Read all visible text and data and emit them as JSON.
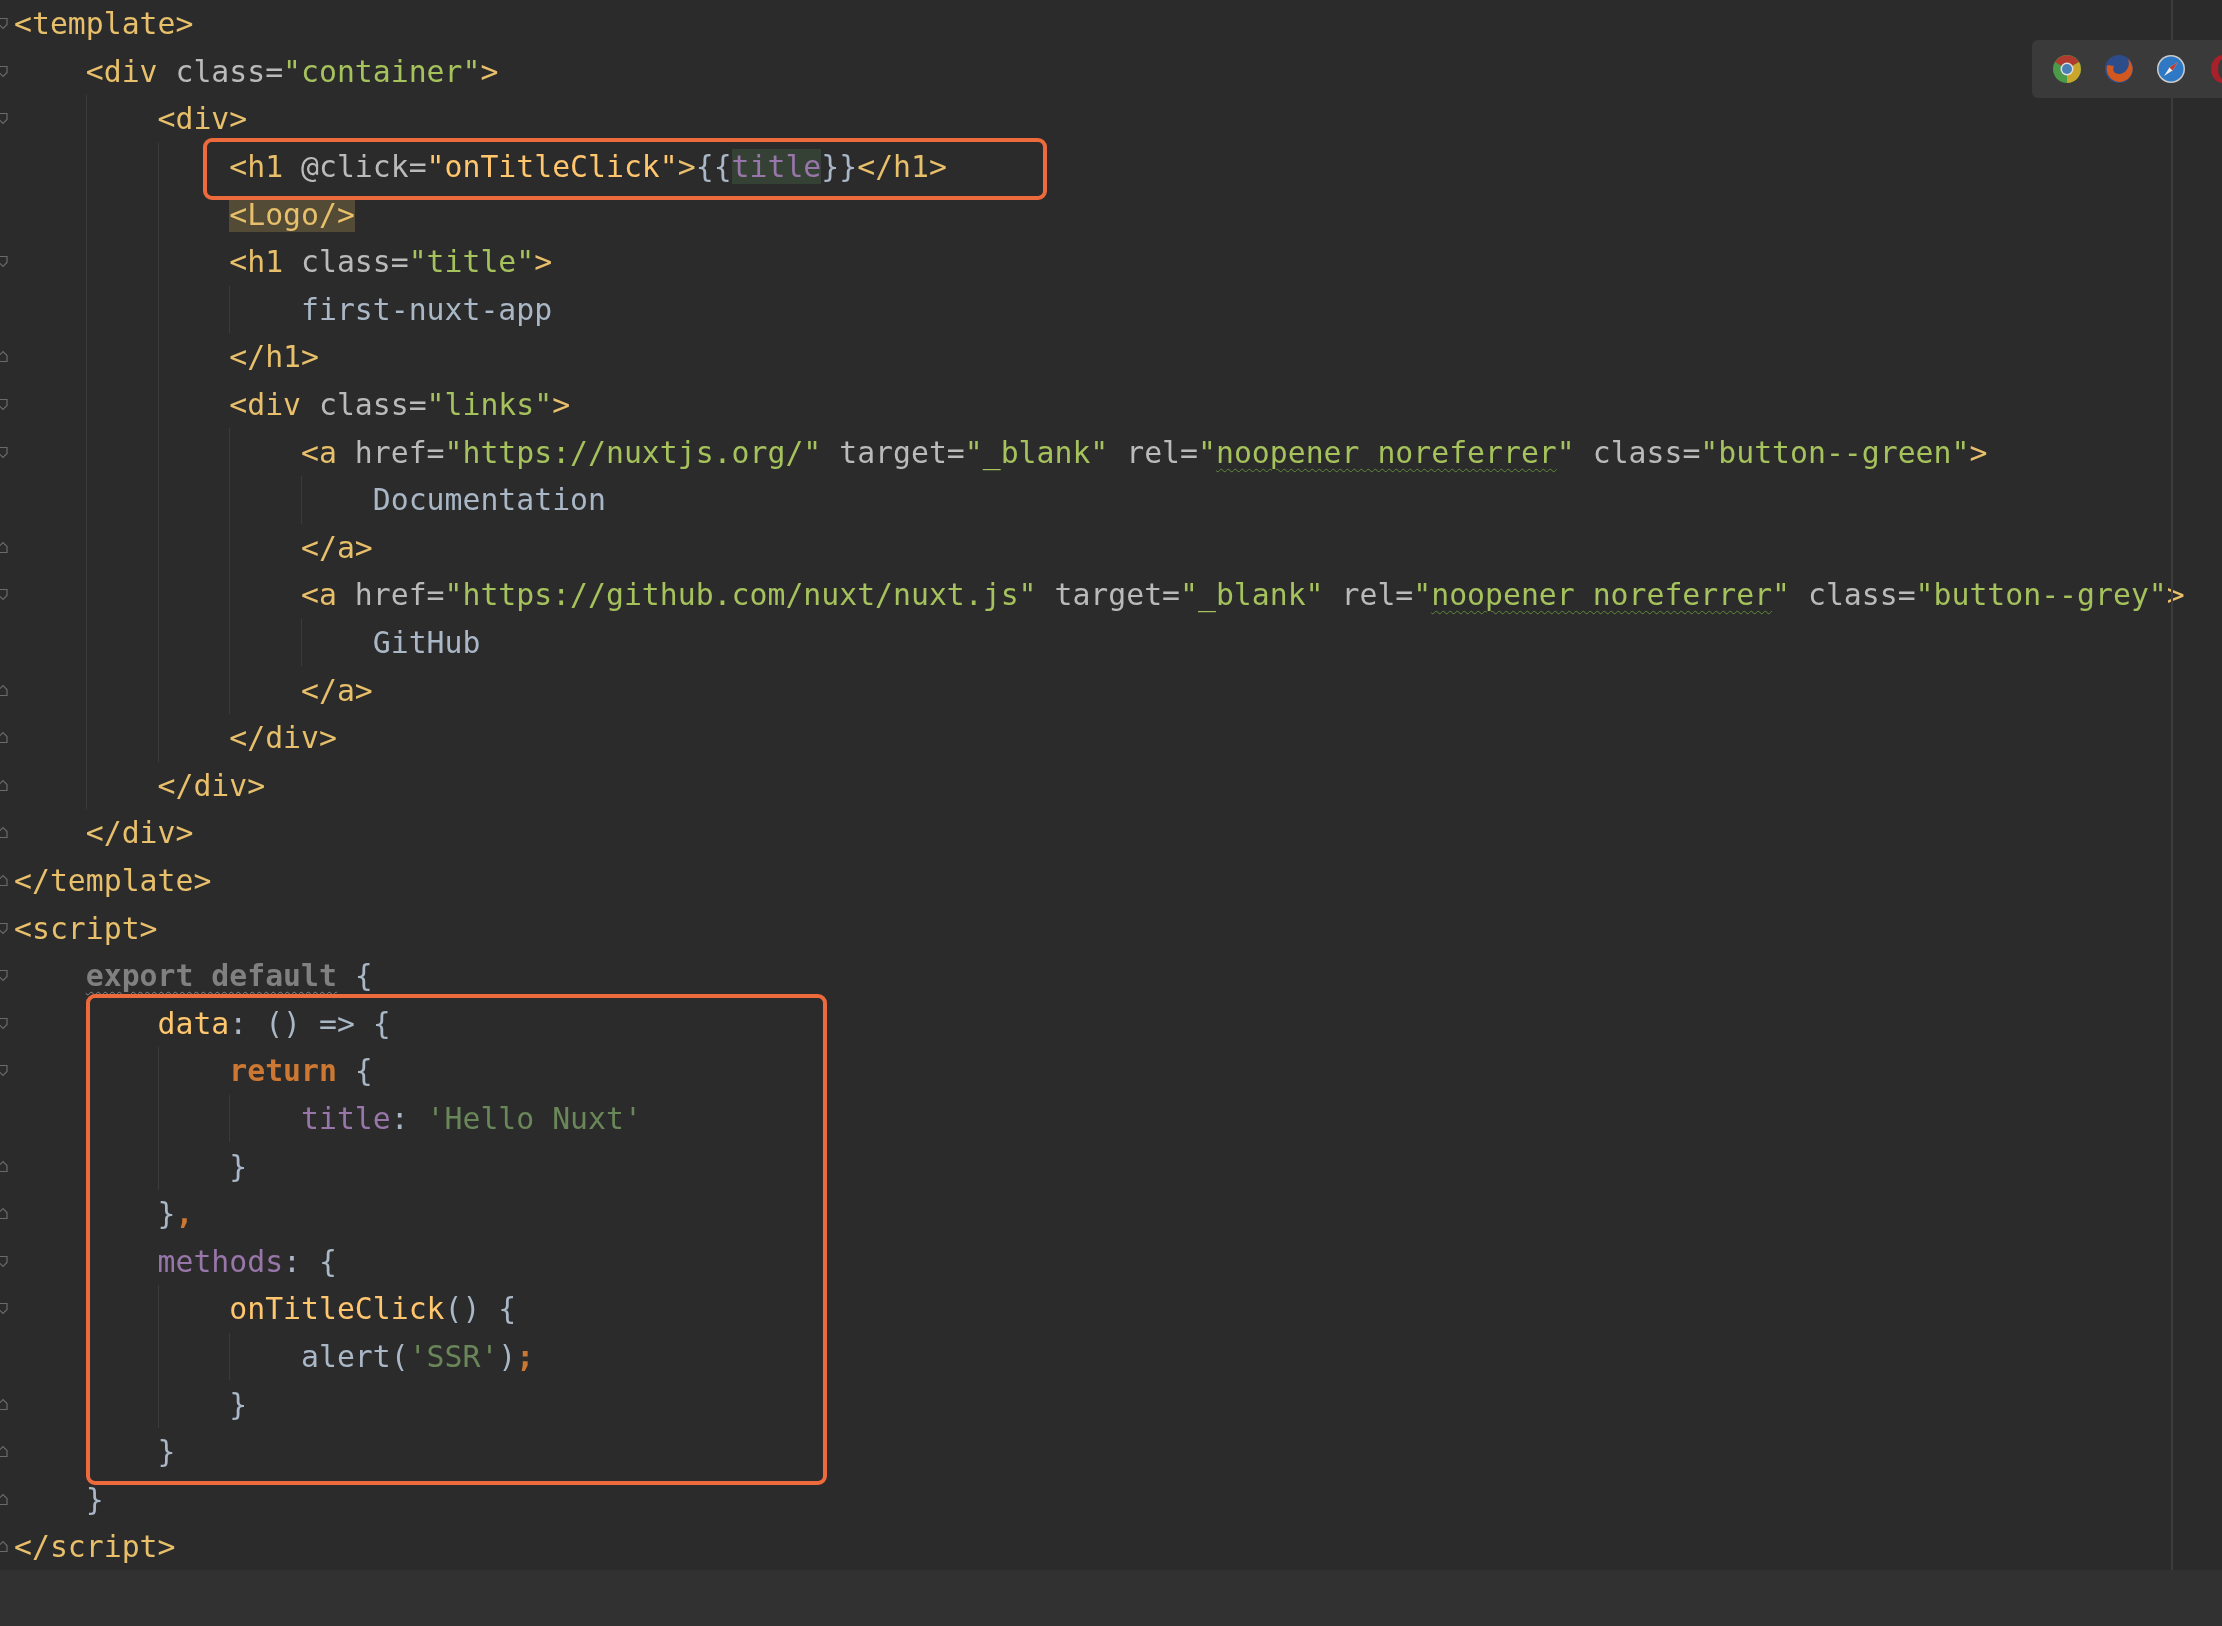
{
  "editor": {
    "lines": [
      {
        "kind": "fold-start",
        "tokens": [
          {
            "text": "<template>",
            "kind": "tag"
          }
        ],
        "children": [
          {
            "kind": "fold-start",
            "tokens": [
              {
                "text": "<div ",
                "kind": "tag"
              },
              {
                "text": "class=",
                "kind": "attr"
              },
              {
                "text": "\"container\"",
                "kind": "str"
              },
              {
                "text": ">",
                "kind": "tag"
              }
            ],
            "children": [
              {
                "kind": "fold-start",
                "tokens": [
                  {
                    "text": "<div>",
                    "kind": "tag"
                  }
                ],
                "children": [
                  {
                    "boxed": true,
                    "tokens": [
                      {
                        "text": "<h1 ",
                        "kind": "tag"
                      },
                      {
                        "text": "@click=",
                        "kind": "attr"
                      },
                      {
                        "text": "\"onTitleClick\"",
                        "kind": "fn"
                      },
                      {
                        "text": ">",
                        "kind": "tag"
                      },
                      {
                        "text": "{{",
                        "kind": "text"
                      },
                      {
                        "text": "title",
                        "kind": "prop",
                        "usage_highlight": true
                      },
                      {
                        "text": "}}",
                        "kind": "text"
                      },
                      {
                        "text": "</h1>",
                        "kind": "tag"
                      }
                    ]
                  },
                  {
                    "tokens": [
                      {
                        "text": "<Logo/>",
                        "kind": "tag",
                        "match_highlight": true
                      }
                    ]
                  },
                  {
                    "kind": "fold-start",
                    "tokens": [
                      {
                        "text": "<h1 ",
                        "kind": "tag"
                      },
                      {
                        "text": "class=",
                        "kind": "attr"
                      },
                      {
                        "text": "\"title\"",
                        "kind": "str"
                      },
                      {
                        "text": ">",
                        "kind": "tag"
                      }
                    ],
                    "children": [
                      {
                        "tokens": [
                          {
                            "text": "first-nuxt-app",
                            "kind": "text"
                          }
                        ]
                      }
                    ]
                  },
                  {
                    "kind": "fold-end",
                    "tokens": [
                      {
                        "text": "</h1>",
                        "kind": "tag"
                      }
                    ]
                  },
                  {
                    "kind": "fold-start",
                    "tokens": [
                      {
                        "text": "<div ",
                        "kind": "tag"
                      },
                      {
                        "text": "class=",
                        "kind": "attr"
                      },
                      {
                        "text": "\"links\"",
                        "kind": "str"
                      },
                      {
                        "text": ">",
                        "kind": "tag"
                      }
                    ],
                    "children": [
                      {
                        "kind": "fold-start",
                        "tokens": [
                          {
                            "text": "<a ",
                            "kind": "tag"
                          },
                          {
                            "text": "href=",
                            "kind": "attr"
                          },
                          {
                            "text": "\"https://nuxtjs.org/\"",
                            "kind": "str"
                          },
                          {
                            "text": " target=",
                            "kind": "attr"
                          },
                          {
                            "text": "\"_blank\"",
                            "kind": "str"
                          },
                          {
                            "text": " rel=",
                            "kind": "attr"
                          },
                          {
                            "text": "\"",
                            "kind": "str"
                          },
                          {
                            "text": "noopener noreferrer",
                            "kind": "str",
                            "squiggle": true
                          },
                          {
                            "text": "\"",
                            "kind": "str"
                          },
                          {
                            "text": " class=",
                            "kind": "attr"
                          },
                          {
                            "text": "\"button--green\"",
                            "kind": "str"
                          },
                          {
                            "text": ">",
                            "kind": "tag"
                          }
                        ],
                        "children": [
                          {
                            "tokens": [
                              {
                                "text": "Documentation",
                                "kind": "text"
                              }
                            ]
                          }
                        ]
                      },
                      {
                        "kind": "fold-end",
                        "tokens": [
                          {
                            "text": "</a>",
                            "kind": "tag"
                          }
                        ]
                      },
                      {
                        "kind": "fold-start",
                        "tokens": [
                          {
                            "text": "<a ",
                            "kind": "tag"
                          },
                          {
                            "text": "href=",
                            "kind": "attr"
                          },
                          {
                            "text": "\"https://github.com/nuxt/nuxt.js\"",
                            "kind": "str"
                          },
                          {
                            "text": " target=",
                            "kind": "attr"
                          },
                          {
                            "text": "\"_blank\"",
                            "kind": "str"
                          },
                          {
                            "text": " rel=",
                            "kind": "attr"
                          },
                          {
                            "text": "\"",
                            "kind": "str"
                          },
                          {
                            "text": "noopener noreferrer",
                            "kind": "str",
                            "squiggle": true
                          },
                          {
                            "text": "\"",
                            "kind": "str"
                          },
                          {
                            "text": " class=",
                            "kind": "attr"
                          },
                          {
                            "text": "\"button--grey\"",
                            "kind": "str"
                          },
                          {
                            "text": ">",
                            "kind": "tag"
                          }
                        ],
                        "children": [
                          {
                            "tokens": [
                              {
                                "text": "GitHub",
                                "kind": "text"
                              }
                            ]
                          }
                        ]
                      },
                      {
                        "kind": "fold-end",
                        "tokens": [
                          {
                            "text": "</a>",
                            "kind": "tag"
                          }
                        ]
                      }
                    ]
                  },
                  {
                    "kind": "fold-end",
                    "tokens": [
                      {
                        "text": "</div>",
                        "kind": "tag"
                      }
                    ]
                  }
                ]
              },
              {
                "kind": "fold-end",
                "tokens": [
                  {
                    "text": "</div>",
                    "kind": "tag"
                  }
                ]
              }
            ]
          },
          {
            "kind": "fold-end",
            "tokens": [
              {
                "text": "</div>",
                "kind": "tag"
              }
            ]
          }
        ]
      },
      {
        "kind": "fold-end",
        "tokens": [
          {
            "text": "</template>",
            "kind": "tag"
          }
        ]
      },
      {
        "kind": "fold-start",
        "tokens": [
          {
            "text": "<script>",
            "kind": "tag"
          }
        ],
        "children": [
          {
            "kind": "fold-start",
            "children_boxed": true,
            "tokens": [
              {
                "text": "export default",
                "kind": "dim",
                "squiggle": true
              },
              {
                "text": " {",
                "kind": "text"
              }
            ],
            "children": [
              {
                "kind": "fold-start",
                "tokens": [
                  {
                    "text": "data",
                    "kind": "fn"
                  },
                  {
                    "text": ": () => {",
                    "kind": "text"
                  }
                ],
                "children": [
                  {
                    "kind": "fold-start",
                    "tokens": [
                      {
                        "text": "return",
                        "kind": "kw"
                      },
                      {
                        "text": " {",
                        "kind": "text"
                      }
                    ],
                    "children": [
                      {
                        "tokens": [
                          {
                            "text": "title",
                            "kind": "prop"
                          },
                          {
                            "text": ": ",
                            "kind": "text"
                          },
                          {
                            "text": "'Hello Nuxt'",
                            "kind": "jsstr"
                          }
                        ]
                      }
                    ]
                  },
                  {
                    "kind": "fold-end",
                    "tokens": [
                      {
                        "text": "}",
                        "kind": "text"
                      }
                    ]
                  }
                ]
              },
              {
                "kind": "fold-end",
                "tokens": [
                  {
                    "text": "}",
                    "kind": "text"
                  },
                  {
                    "text": ",",
                    "kind": "kw"
                  }
                ]
              },
              {
                "kind": "fold-start",
                "tokens": [
                  {
                    "text": "methods",
                    "kind": "prop"
                  },
                  {
                    "text": ": {",
                    "kind": "text"
                  }
                ],
                "children": [
                  {
                    "kind": "fold-start",
                    "tokens": [
                      {
                        "text": "onTitleClick",
                        "kind": "fn"
                      },
                      {
                        "text": "() {",
                        "kind": "text"
                      }
                    ],
                    "children": [
                      {
                        "tokens": [
                          {
                            "text": "alert(",
                            "kind": "text"
                          },
                          {
                            "text": "'SSR'",
                            "kind": "jsstr"
                          },
                          {
                            "text": ")",
                            "kind": "text"
                          },
                          {
                            "text": ";",
                            "kind": "kw"
                          }
                        ]
                      }
                    ]
                  },
                  {
                    "kind": "fold-end",
                    "tokens": [
                      {
                        "text": "}",
                        "kind": "text"
                      }
                    ]
                  }
                ]
              },
              {
                "kind": "fold-end",
                "tokens": [
                  {
                    "text": "}",
                    "kind": "text"
                  }
                ]
              }
            ]
          },
          {
            "kind": "fold-end",
            "tokens": [
              {
                "text": "}",
                "kind": "text"
              }
            ]
          }
        ]
      },
      {
        "kind": "fold-end",
        "tokens": [
          {
            "text": "</script>",
            "kind": "tag"
          }
        ]
      }
    ]
  }
}
